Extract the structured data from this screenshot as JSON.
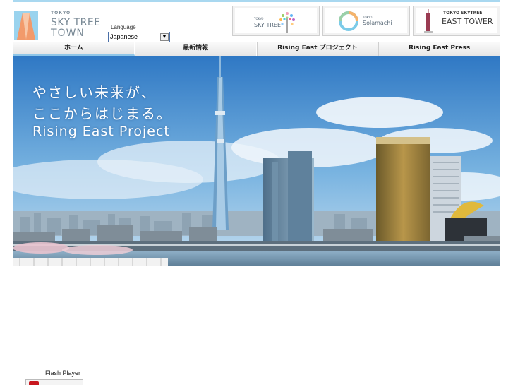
{
  "header": {
    "logo": {
      "tokyo": "TOKYO",
      "line1": "SKY TREE",
      "line2": "TOWN"
    },
    "language": {
      "label": "Language",
      "selected": "Japanese"
    },
    "banners": [
      {
        "small": "TOKYO",
        "main": "SKY TREE"
      },
      {
        "small": "TOKYO",
        "main": "Solamachi"
      },
      {
        "top": "TOKYO SKYTREE",
        "main": "EAST TOWER"
      }
    ]
  },
  "nav": {
    "items": [
      {
        "label": "ホーム"
      },
      {
        "label": "最新情報"
      },
      {
        "label": "Rising East プロジェクト"
      },
      {
        "label": "Rising East Press"
      }
    ]
  },
  "hero": {
    "line1": "やさしい未来が、",
    "line2": "ここからはじまる。",
    "line3": "Rising East Project"
  },
  "footer": {
    "flash_label": "Flash Player"
  },
  "colors": {
    "accent": "#8fc6e8",
    "sky_top": "#2f78c4",
    "sky_bottom": "#a9cfe8"
  }
}
